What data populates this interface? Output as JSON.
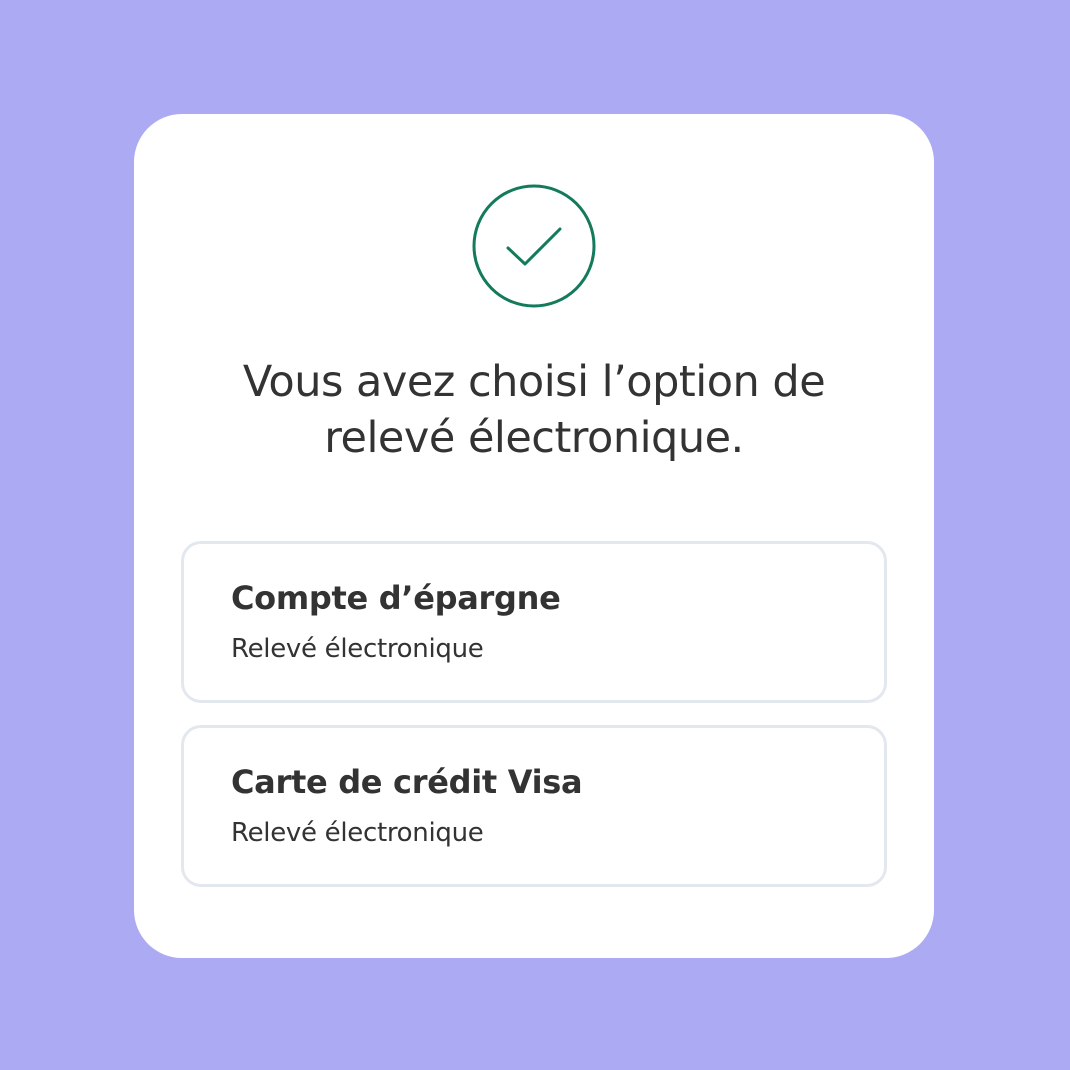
{
  "confirmation": {
    "icon": "check-circle-icon",
    "accent_color": "#147a5c",
    "message_line1": "Vous avez choisi l’option de",
    "message_line2": "relevé électronique."
  },
  "accounts": [
    {
      "name": "Compte d’épargne",
      "status": "Relevé électronique"
    },
    {
      "name": "Carte de crédit Visa",
      "status": "Relevé électronique"
    }
  ],
  "colors": {
    "background": "#adaaf4",
    "card": "#ffffff",
    "card_border": "#e3e8ee",
    "text": "#333333"
  }
}
